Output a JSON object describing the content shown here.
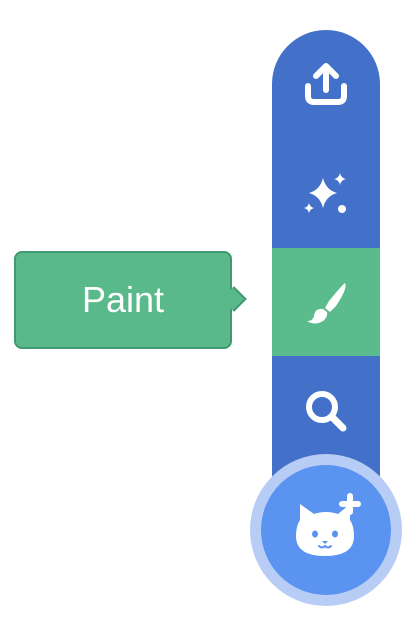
{
  "tooltip": {
    "label": "Paint"
  },
  "menu": {
    "items": [
      {
        "id": "upload",
        "icon": "upload-icon"
      },
      {
        "id": "surprise",
        "icon": "sparkle-icon"
      },
      {
        "id": "paint",
        "icon": "paintbrush-icon",
        "active": true
      },
      {
        "id": "search",
        "icon": "search-icon"
      }
    ],
    "fab_icon": "cat-add-icon"
  },
  "colors": {
    "menu_blue": "#4370c8",
    "active_green": "#5abb8c",
    "tooltip_green": "#59b98a",
    "fab_blue": "#5b93f1",
    "fab_halo": "#b8cdf6"
  }
}
